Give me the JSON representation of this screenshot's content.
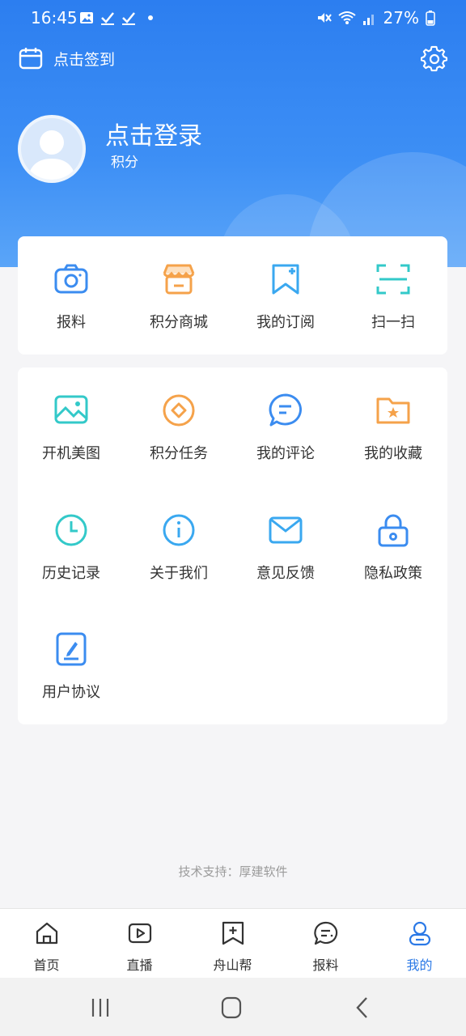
{
  "status_bar": {
    "time": "16:45",
    "battery": "27%"
  },
  "header": {
    "signin_label": "点击签到",
    "login_title": "点击登录",
    "points_label": "积分"
  },
  "quick_actions": [
    {
      "label": "报料",
      "icon": "camera-icon",
      "color": "#3b8cf0"
    },
    {
      "label": "积分商城",
      "icon": "store-icon",
      "color": "#f5a24a"
    },
    {
      "label": "我的订阅",
      "icon": "bookmark-add-icon",
      "color": "#3aa8f0"
    },
    {
      "label": "扫一扫",
      "icon": "scan-icon",
      "color": "#33c9c9"
    }
  ],
  "menu": [
    {
      "label": "开机美图",
      "icon": "image-icon",
      "color": "#33c9c9"
    },
    {
      "label": "积分任务",
      "icon": "points-task-icon",
      "color": "#f5a24a"
    },
    {
      "label": "我的评论",
      "icon": "comment-icon",
      "color": "#3b8cf0"
    },
    {
      "label": "我的收藏",
      "icon": "favorite-folder-icon",
      "color": "#f5a24a"
    },
    {
      "label": "历史记录",
      "icon": "clock-icon",
      "color": "#33c9c9"
    },
    {
      "label": "关于我们",
      "icon": "info-icon",
      "color": "#3aa8f0"
    },
    {
      "label": "意见反馈",
      "icon": "mail-icon",
      "color": "#3aa8f0"
    },
    {
      "label": "隐私政策",
      "icon": "lock-icon",
      "color": "#3b8cf0"
    },
    {
      "label": "用户协议",
      "icon": "edit-doc-icon",
      "color": "#3b8cf0"
    }
  ],
  "footer": {
    "support_text": "技术支持：厚建软件"
  },
  "tabs": [
    {
      "label": "首页",
      "icon": "home-icon",
      "active": false
    },
    {
      "label": "直播",
      "icon": "play-icon",
      "active": false
    },
    {
      "label": "舟山帮",
      "icon": "plus-bookmark-icon",
      "active": false
    },
    {
      "label": "报料",
      "icon": "chat-icon",
      "active": false
    },
    {
      "label": "我的",
      "icon": "user-icon",
      "active": true
    }
  ],
  "colors": {
    "accent": "#2b79e6",
    "header_top": "#2c7ef0"
  }
}
